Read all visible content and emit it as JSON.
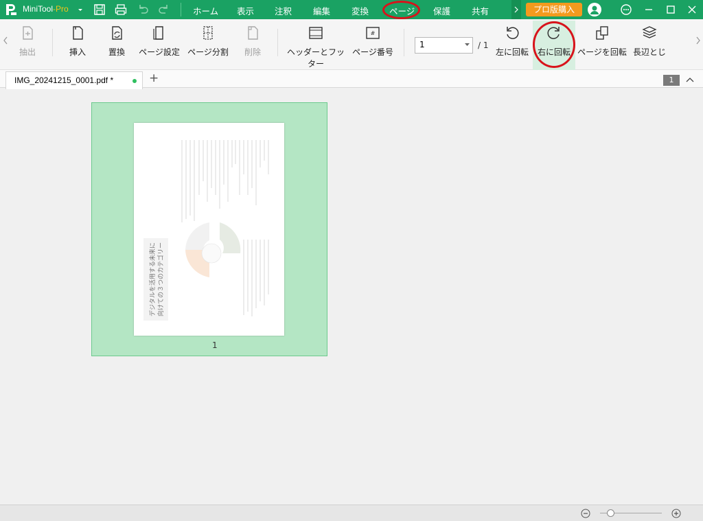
{
  "app": {
    "name": "MiniTool",
    "suffix": "-Pro"
  },
  "menu": [
    "ホーム",
    "表示",
    "注釈",
    "編集",
    "変換",
    "ページ",
    "保護",
    "共有"
  ],
  "buy_button": "プロ版購入",
  "toolbar": {
    "extract": "抽出",
    "insert": "挿入",
    "replace": "置換",
    "page_setup": "ページ設定",
    "split": "ページ分割",
    "delete": "削除",
    "header_footer": "ヘッダーとフッター",
    "page_number": "ページ番号",
    "page_input": "1",
    "page_total": "/ 1",
    "rotate_left": "左に回転",
    "rotate_right": "右に回転",
    "rotate_page": "ページを回転",
    "long_edge": "長辺とじ"
  },
  "tab": {
    "filename": "IMG_20241215_0001.pdf *",
    "add": "+",
    "count": "1"
  },
  "thumbnail": {
    "page_label": "1",
    "page_title_line1": "デジタルを活用する未来に",
    "page_title_line2": "向けての３つのカテゴリー"
  },
  "colors": {
    "brand": "#1aa263",
    "buy": "#f39a1e",
    "highlight": "#d8131b",
    "selection": "#b4e6c4"
  }
}
